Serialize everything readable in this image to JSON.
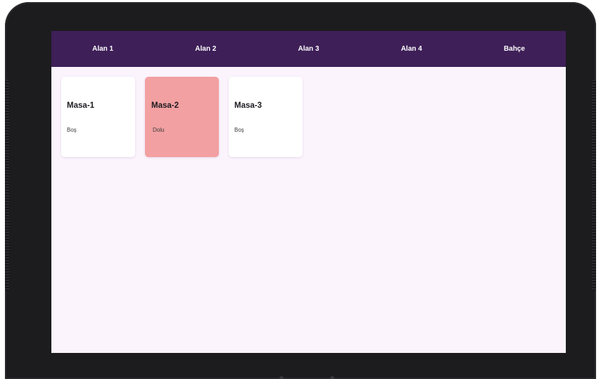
{
  "tabs": [
    {
      "label": "Alan 1"
    },
    {
      "label": "Alan 2"
    },
    {
      "label": "Alan 3"
    },
    {
      "label": "Alan 4"
    },
    {
      "label": "Bahçe"
    }
  ],
  "tables": [
    {
      "name": "Masa-1",
      "status": "Boş"
    },
    {
      "name": "Masa-2",
      "status": "Dolu"
    },
    {
      "name": "Masa-3",
      "status": "Boş"
    }
  ],
  "colors": {
    "tabbar_bg": "#3e1f58",
    "screen_bg": "#fcf4fd",
    "occupied_card": "#f2a0a1",
    "empty_card": "#ffffff"
  }
}
